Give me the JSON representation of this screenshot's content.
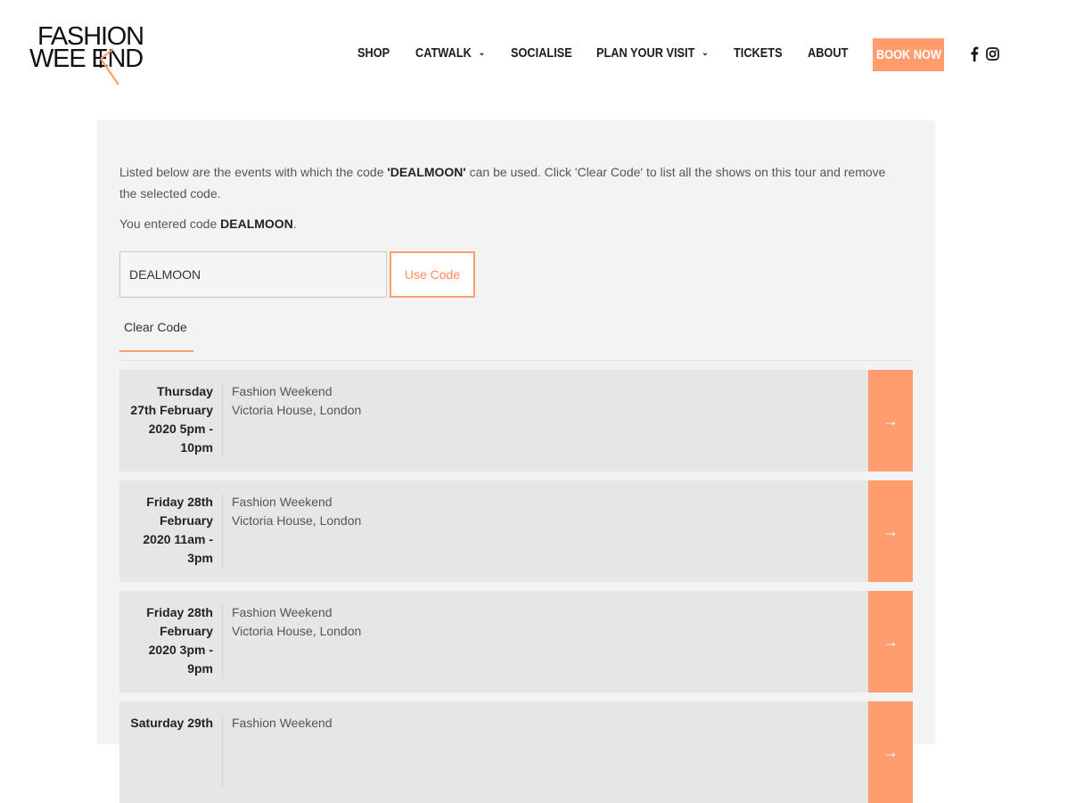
{
  "logo": {
    "line1": "FASHION",
    "line2": "WEE END"
  },
  "nav": {
    "items": [
      {
        "label": "SHOP"
      },
      {
        "label": "CATWALK"
      },
      {
        "label": "SOCIALISE"
      },
      {
        "label": "PLAN YOUR VISIT"
      },
      {
        "label": "TICKETS"
      },
      {
        "label": "ABOUT"
      }
    ],
    "book_now": "BOOK NOW",
    "chevron": "⌄"
  },
  "promo": {
    "intro_before": "Listed below are the events with which the code ",
    "intro_code": "'DEALMOON'",
    "intro_after": " can be used. Click 'Clear Code' to list all the shows on this tour and remove the selected code.",
    "entered_prefix": "You entered code ",
    "entered_code": "DEALMOON",
    "entered_suffix": ".",
    "input_value": "DEALMOON",
    "use_code_label": "Use Code",
    "clear_code_label": "Clear Code"
  },
  "events": [
    {
      "date_lines": [
        "Thursday",
        "27th February",
        "2020 5pm -",
        "10pm"
      ],
      "name": "Fashion Weekend",
      "venue": "Victoria House, London"
    },
    {
      "date_lines": [
        "Friday 28th",
        "February",
        "2020 11am -",
        "3pm"
      ],
      "name": "Fashion Weekend",
      "venue": "Victoria House, London"
    },
    {
      "date_lines": [
        "Friday 28th",
        "February",
        "2020 3pm -",
        "9pm"
      ],
      "name": "Fashion Weekend",
      "venue": "Victoria House, London"
    },
    {
      "date_lines": [
        "Saturday 29th",
        "",
        "",
        ""
      ],
      "name": "Fashion Weekend",
      "venue": ""
    }
  ],
  "icons": {
    "arrow": "→",
    "facebook": "facebook-icon",
    "instagram": "instagram-icon"
  },
  "colors": {
    "accent": "#ff9d6e",
    "panel_bg": "#f3f3f3",
    "row_bg": "#e6e6e6"
  }
}
